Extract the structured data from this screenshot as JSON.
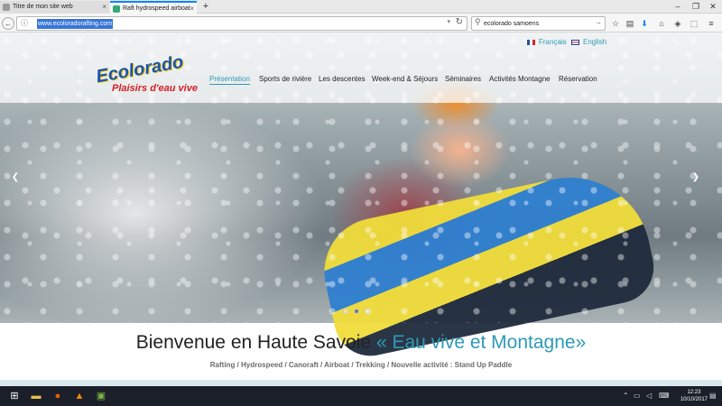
{
  "browser": {
    "tabs": [
      {
        "title": "Titre de mon site web"
      },
      {
        "title": "Raft hydrospeed airboat"
      }
    ],
    "url": "www.ecoloradorafting.com",
    "search_query": "ecolorado samoens"
  },
  "site": {
    "logo_text": "Ecolorado",
    "logo_tagline": "Plaisirs d'eau vive",
    "languages": [
      "Français",
      "English"
    ],
    "nav": [
      "Présentation",
      "Sports de rivière",
      "Les descentes",
      "Week-end & Séjours",
      "Séminaires",
      "Activités Montagne",
      "Réservation"
    ],
    "active_nav": "Présentation",
    "accent_color": "#2e9ab5",
    "carousel": {
      "slides": 3,
      "active_index": 1
    },
    "welcome": {
      "main": "Bienvenue en Haute Savoie ",
      "highlight": "« Eau vive et Montagne»"
    },
    "activities": "Rafting / Hydrospeed / Canoraft / Airboat / Trekking / Nouvelle activité : Stand Up Paddle"
  },
  "taskbar": {
    "time": "12:23",
    "date": "10/10/2017"
  }
}
